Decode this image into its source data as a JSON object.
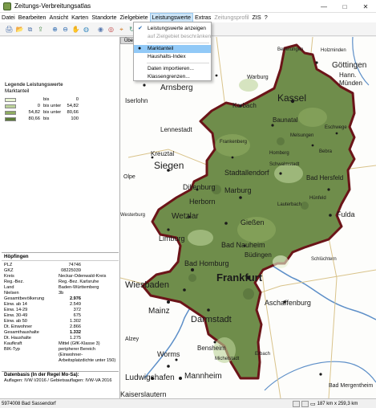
{
  "window": {
    "title": "Zeitungs-Verbreitungsatlas",
    "controls": [
      "—",
      "□",
      "✕"
    ]
  },
  "menu": [
    "Datei",
    "Bearbeiten",
    "Ansicht",
    "Karten",
    "Standorte",
    "Zielgebiete",
    "Leistungswerte",
    "Extras",
    "Zeitungsprofil",
    "ZIS",
    "?"
  ],
  "menu_active": "Leistungswerte",
  "menu_disabled": [
    "Zeitungsprofil"
  ],
  "toolbar_icons": [
    "print-icon",
    "open-icon",
    "copy-icon",
    "export-icon",
    "zoom-in-icon",
    "zoom-out-icon",
    "pan-hand-icon",
    "search-globe-icon",
    "locate-icon",
    "target-icon",
    "marker-icon",
    "rotate-icon",
    "flag-icon"
  ],
  "dropdown": {
    "items": [
      {
        "label": "Leistungswerte anzeigen",
        "checked": true,
        "disabled": false
      },
      {
        "label": "auf Zielgebiet beschränken",
        "checked": false,
        "disabled": true
      },
      {
        "label": "Marktanteil",
        "radio": true,
        "selected": true
      },
      {
        "label": "Haushalts-Index",
        "radio": false,
        "selected": false
      },
      {
        "label": "Daten importieren...",
        "disabled": false
      },
      {
        "label": "Klassengrenzen...",
        "disabled": false
      }
    ]
  },
  "map_tab": "Überb",
  "legend": {
    "title": "Legende Leistungswerte",
    "subtitle": "Marktanteil",
    "rows": [
      {
        "color": "#e7f3d1",
        "from": "",
        "op": "bis",
        "to": "0"
      },
      {
        "color": "#bcd39a",
        "from": "0",
        "op": "bis unter",
        "to": "54,82"
      },
      {
        "color": "#8fac62",
        "from": "54,82",
        "op": "bis unter",
        "to": "80,66"
      },
      {
        "color": "#5d7c3a",
        "from": "80,66",
        "op": "bis",
        "to": "100"
      }
    ]
  },
  "info": {
    "title": "Höpfingen",
    "rows": [
      {
        "k": "PLZ",
        "v": "74746"
      },
      {
        "k": "GKZ",
        "v": "08225039"
      },
      {
        "k": "Kreis",
        "v": "Neckar-Odenwald-Kreis"
      },
      {
        "k": "Reg.-Bez.",
        "v": "Reg.-Bez. Karlsruhe"
      },
      {
        "k": "Land",
        "v": "Baden-Württemberg"
      },
      {
        "k": "Nielsen",
        "v": "3b"
      },
      {
        "k": "Gesamtbevölkerung",
        "v": "2.976",
        "bold": true
      },
      {
        "k": "Einw. ab 14",
        "v": "2.549"
      },
      {
        "k": "Einw. 14-29",
        "v": "372"
      },
      {
        "k": "Einw. 30-49",
        "v": "675"
      },
      {
        "k": "Einw. ab 50",
        "v": "1.302"
      },
      {
        "k": "Dt. Einwohner",
        "v": "2.866"
      },
      {
        "k": "Gesamthaushalte",
        "v": "1.332",
        "bold": true
      },
      {
        "k": "Dt. Haushalte",
        "v": "1.275"
      },
      {
        "k": "Kaufkraft",
        "v": "Mittel (GfK-Klasse 3)"
      },
      {
        "k": "BIK-Typ",
        "v": "peripherer Bereich (Einwohner-Arbeitsplatzdichte unter 150)"
      }
    ]
  },
  "daten": {
    "title": "Datenbasis (In der Regel Mo-Sa):",
    "text": "Auflagen: IVW I/2016 / Gebietsauflagen: IVW-VA 2016"
  },
  "status": {
    "left": "5974008 Bad Sassendorf",
    "scale": "187 km x 259,3 km"
  },
  "map": {
    "region_fill": "#6f8d4b",
    "border_color": "#6b1418",
    "city_labels": [
      "Göttingen",
      "Hann.",
      "Münden",
      "Kassel",
      "Korbach",
      "Baunatal",
      "Eschwege",
      "Warburg",
      "Beverungen",
      "Holzminden",
      "Arnsberg",
      "Iserlohn",
      "Lennestadt",
      "Kreuztal",
      "Siegen",
      "Olpe",
      "Marburg",
      "Stadtallendorf",
      "Bad Hersfeld",
      "Dillenburg",
      "Herborn",
      "Wetzlar",
      "Gießen",
      "Fulda",
      "Limburg",
      "Bad Nauheim",
      "Büdingen",
      "Bad Homburg",
      "Frankfurt",
      "Wiesbaden",
      "Mainz",
      "Darmstadt",
      "Aschaffenburg",
      "Bensheim",
      "Alzey",
      "Worms",
      "Ludwigshafen",
      "Mannheim",
      "Kaiserslautern",
      "Bad Mergentheim",
      "Westerburg",
      "Homberg",
      "Hünfeld",
      "Schlüchtern",
      "Schwalmstadt",
      "Lauterbach",
      "Michelstadt",
      "Erbach",
      "Frankenberg",
      "Bebra",
      "Melsungen"
    ]
  }
}
